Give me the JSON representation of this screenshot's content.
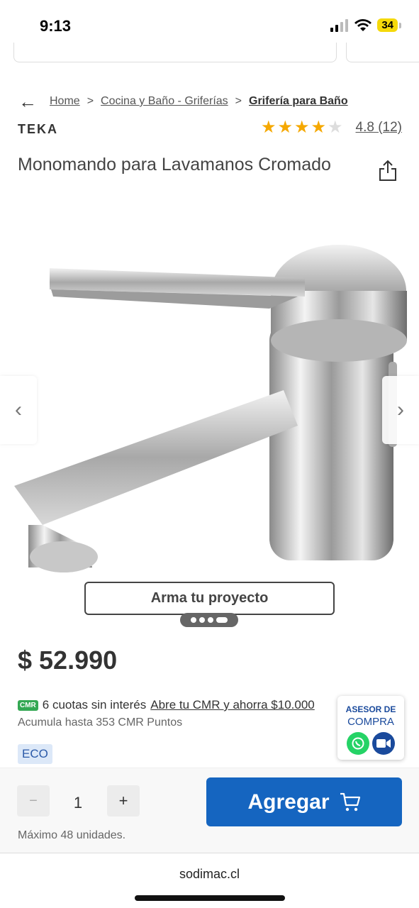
{
  "status": {
    "time": "9:13",
    "battery": "34"
  },
  "breadcrumb": {
    "items": [
      "Home",
      "Cocina y Baño - Griferías",
      "Grifería para Baño"
    ],
    "separator": ">"
  },
  "product": {
    "brand": "TEKA",
    "rating": 4.8,
    "rating_stars_filled": 4,
    "rating_text": "4.8 (12)",
    "title": "Monomando para Lavamanos Cromado",
    "price": "$ 52.990",
    "gallery_image_icon": "faucet-chrome-image",
    "gallery_dots": 4,
    "gallery_active_dot": 4
  },
  "project_button": "Arma tu proyecto",
  "cmr": {
    "badge": "CMR",
    "installments": "6 cuotas sin interés",
    "link": "Abre tu CMR y ahorra $10.000",
    "points": "Acumula hasta 353 CMR Puntos"
  },
  "eco_badge": "ECO",
  "advisor": {
    "line1": "ASESOR DE",
    "line2": "COMPRA"
  },
  "cart": {
    "minus": "−",
    "quantity": "1",
    "plus": "+",
    "add_label": "Agregar",
    "max_units": "Máximo 48 unidades."
  },
  "footer": {
    "url": "sodimac.cl"
  },
  "colors": {
    "primary": "#1565c0",
    "star": "#f5a800",
    "cmr_green": "#34a853",
    "eco_bg": "#dce8f8"
  }
}
